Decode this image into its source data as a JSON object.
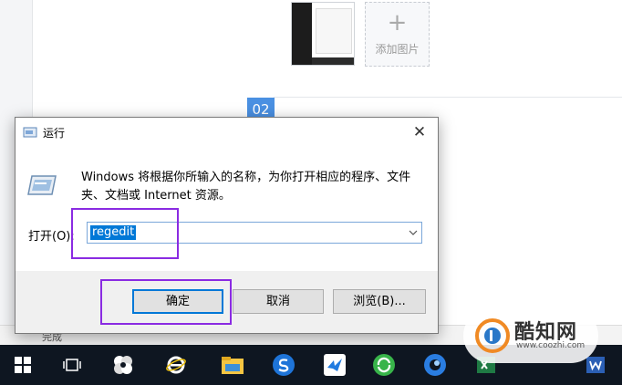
{
  "background": {
    "add_image_plus": "+",
    "add_image_label": "添加图片",
    "step_number": "02",
    "status_text": "完成",
    "accent_color": "#4a90e2"
  },
  "dialog": {
    "title": "运行",
    "close_glyph": "✕",
    "description": "Windows 将根据你所输入的名称，为你打开相应的程序、文件夹、文档或 Internet 资源。",
    "open_label": "打开(O):",
    "command_value": "regedit",
    "buttons": {
      "ok": "确定",
      "cancel": "取消",
      "browse": "浏览(B)..."
    },
    "highlight_color": "#8a2be2"
  },
  "taskbar": {
    "items": [
      {
        "icon": "windows-start-icon"
      },
      {
        "icon": "task-view-icon"
      },
      {
        "icon": "pinwheel-app-icon"
      },
      {
        "icon": "internet-explorer-icon"
      },
      {
        "icon": "file-explorer-icon"
      },
      {
        "icon": "sogou-browser-icon"
      },
      {
        "icon": "feishu-bird-icon"
      },
      {
        "icon": "green-refresh-app-icon"
      },
      {
        "icon": "blue-circle-app-icon"
      },
      {
        "icon": "excel-icon"
      },
      {
        "icon": "word-icon"
      }
    ]
  },
  "watermark": {
    "title": "酷知网",
    "url": "www.coozhi.com"
  }
}
